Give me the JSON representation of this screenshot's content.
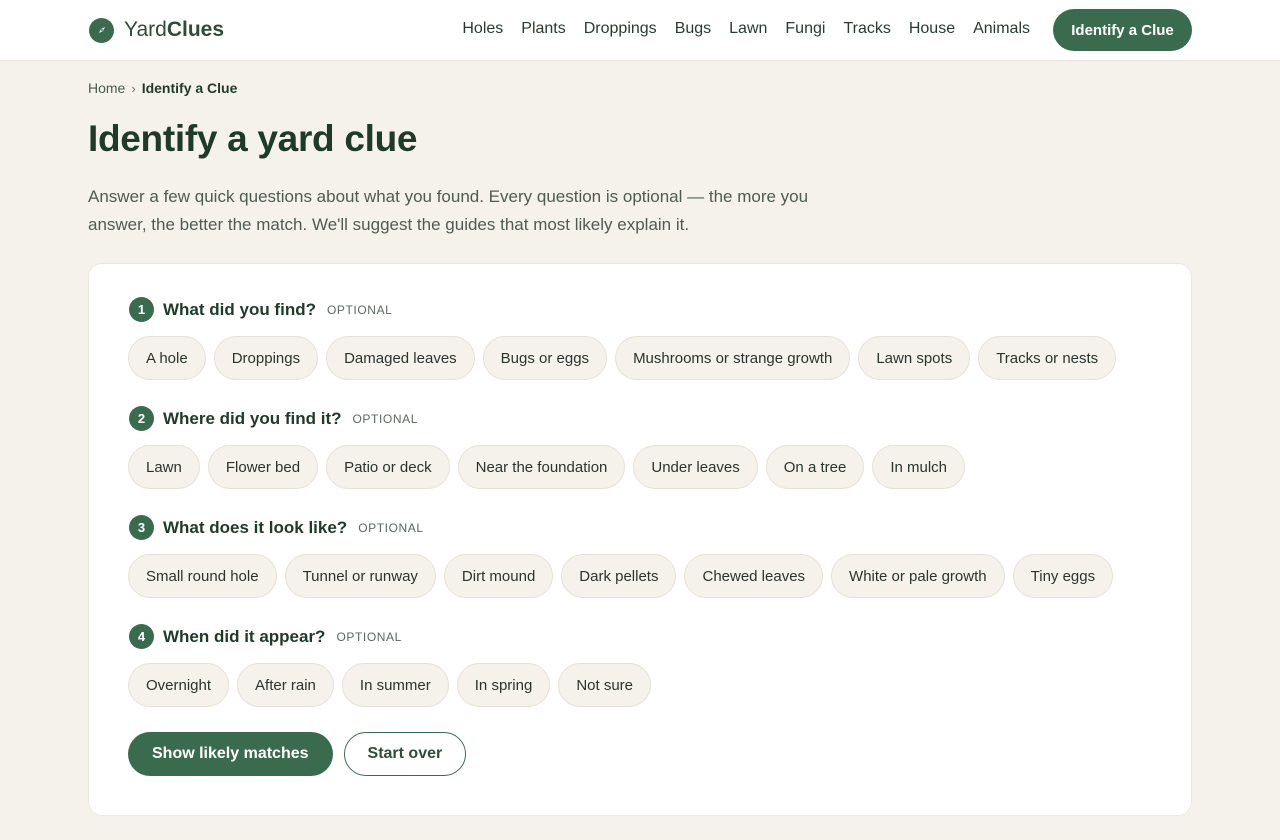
{
  "header": {
    "brand_part1": "Yard",
    "brand_part2": "Clues",
    "logo_icon": "compass-icon",
    "nav": [
      "Holes",
      "Plants",
      "Droppings",
      "Bugs",
      "Lawn",
      "Fungi",
      "Tracks",
      "House",
      "Animals"
    ],
    "cta_label": "Identify a Clue"
  },
  "breadcrumb": {
    "home": "Home",
    "separator": "›",
    "current": "Identify a Clue"
  },
  "page": {
    "title": "Identify a yard clue",
    "intro": "Answer a few quick questions about what you found. Every question is optional — the more you answer, the better the match. We'll suggest the guides that most likely explain it."
  },
  "questions": [
    {
      "number": "1",
      "text": "What did you find?",
      "badge": "OPTIONAL",
      "options": [
        "A hole",
        "Droppings",
        "Damaged leaves",
        "Bugs or eggs",
        "Mushrooms or strange growth",
        "Lawn spots",
        "Tracks or nests"
      ]
    },
    {
      "number": "2",
      "text": "Where did you find it?",
      "badge": "OPTIONAL",
      "options": [
        "Lawn",
        "Flower bed",
        "Patio or deck",
        "Near the foundation",
        "Under leaves",
        "On a tree",
        "In mulch"
      ]
    },
    {
      "number": "3",
      "text": "What does it look like?",
      "badge": "OPTIONAL",
      "options": [
        "Small round hole",
        "Tunnel or runway",
        "Dirt mound",
        "Dark pellets",
        "Chewed leaves",
        "White or pale growth",
        "Tiny eggs"
      ]
    },
    {
      "number": "4",
      "text": "When did it appear?",
      "badge": "OPTIONAL",
      "options": [
        "Overnight",
        "After rain",
        "In summer",
        "In spring",
        "Not sure"
      ]
    }
  ],
  "actions": {
    "primary": "Show likely matches",
    "secondary": "Start over"
  },
  "colors": {
    "accent": "#3b6b4f",
    "background": "#f5f2ec",
    "chip_bg": "#f5f2ec",
    "text": "#1f3a2a"
  }
}
